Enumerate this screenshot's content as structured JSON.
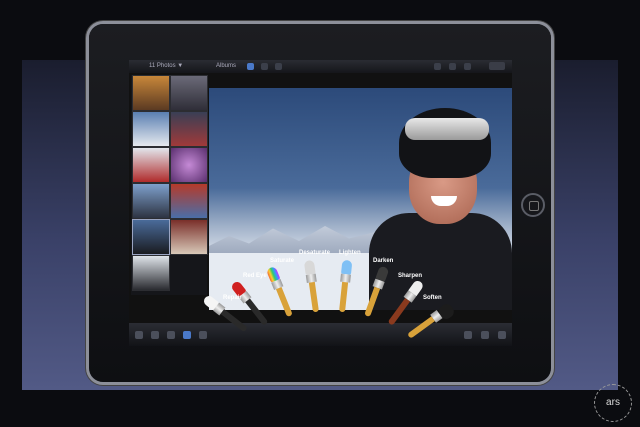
{
  "toolbar": {
    "photos_label": "11 Photos ▼",
    "albums_label": "Albums"
  },
  "brushes": [
    {
      "label": "Repair"
    },
    {
      "label": "Red Eye"
    },
    {
      "label": "Saturate"
    },
    {
      "label": "Desaturate"
    },
    {
      "label": "Lighten"
    },
    {
      "label": "Darken"
    },
    {
      "label": "Sharpen"
    },
    {
      "label": "Soften"
    }
  ],
  "watermark": "ars",
  "colors": {
    "selected_tool": "#4a79c9",
    "brush_handle": "#d9a23a"
  }
}
